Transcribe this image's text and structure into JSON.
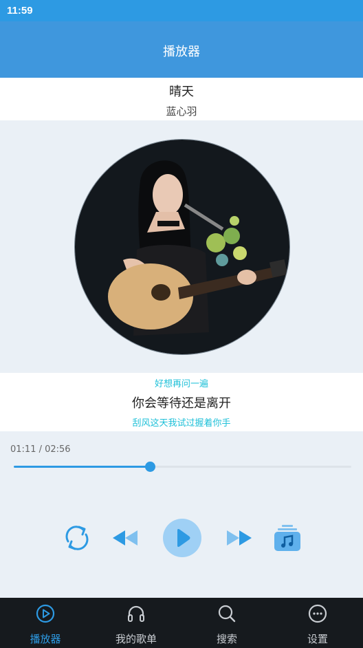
{
  "status_bar": {
    "time": "11:59"
  },
  "app_bar": {
    "title": "播放器"
  },
  "song": {
    "title": "晴天",
    "artist": "蓝心羽"
  },
  "lyrics": {
    "previous": "好想再问一遍",
    "current": "你会等待还是离开",
    "next": "刮风这天我试过握着你手"
  },
  "playback": {
    "position": "01:11",
    "duration": "02:56",
    "time_display": "01:11 / 02:56",
    "progress": 0.403
  },
  "controls": [
    "repeat-icon",
    "previous-icon",
    "play-icon",
    "next-icon",
    "playlist-icon"
  ],
  "tabs": [
    {
      "label": "播放器",
      "icon": "play-circle-icon",
      "active": true
    },
    {
      "label": "我的歌单",
      "icon": "headphones-icon",
      "active": false
    },
    {
      "label": "搜索",
      "icon": "search-icon",
      "active": false
    },
    {
      "label": "设置",
      "icon": "more-icon",
      "active": false
    }
  ],
  "colors": {
    "accent": "#2d9ae3",
    "lyric_highlight": "#1ec0d8",
    "tabbar": "#161a1e"
  }
}
